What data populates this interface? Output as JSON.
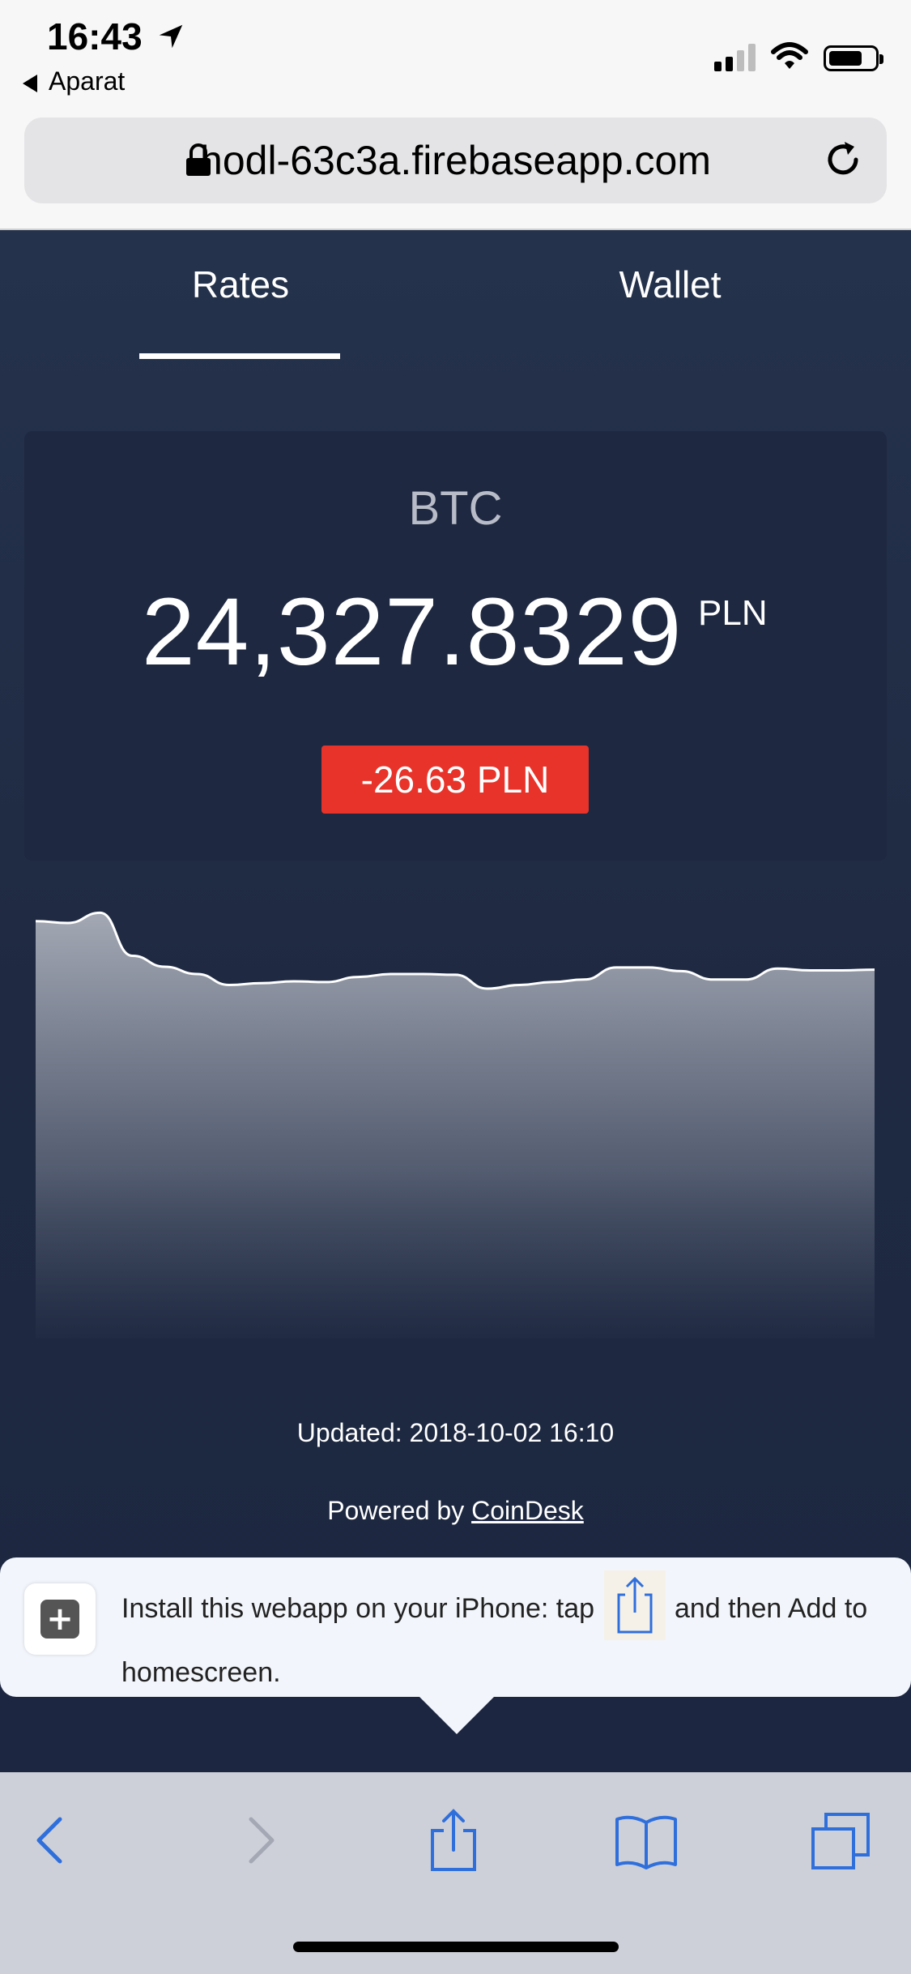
{
  "status_bar": {
    "time": "16:43",
    "back_app": "Aparat"
  },
  "browser": {
    "url": "hodl-63c3a.firebaseapp.com"
  },
  "tabs": [
    {
      "label": "Rates",
      "active": true
    },
    {
      "label": "Wallet",
      "active": false
    }
  ],
  "rate": {
    "coin": "BTC",
    "price": "24,327.8329",
    "currency": "PLN",
    "change": "-26.63 PLN",
    "change_color": "#e8332a"
  },
  "chart_data": {
    "type": "area",
    "title": "",
    "xlabel": "",
    "ylabel": "",
    "values": [
      24545,
      24540,
      24568,
      24450,
      24420,
      24400,
      24370,
      24375,
      24380,
      24378,
      24392,
      24400,
      24400,
      24398,
      24360,
      24370,
      24378,
      24385,
      24418,
      24418,
      24408,
      24385,
      24385,
      24415,
      24410,
      24410,
      24412
    ],
    "ylim": [
      23400,
      24600
    ],
    "grid": false
  },
  "footer": {
    "updated": "Updated: 2018-10-02 16:10",
    "powered_prefix": "Powered by ",
    "powered_link": "CoinDesk"
  },
  "install_prompt": {
    "text_before": "Install this webapp on your iPhone: tap",
    "text_after": "and then Add to homescreen."
  },
  "toolbar": {
    "icons": [
      "back-icon",
      "forward-icon",
      "share-icon",
      "bookmarks-icon",
      "tabs-icon"
    ]
  },
  "colors": {
    "accent": "#2f6fdc",
    "background": "#1f2940"
  }
}
